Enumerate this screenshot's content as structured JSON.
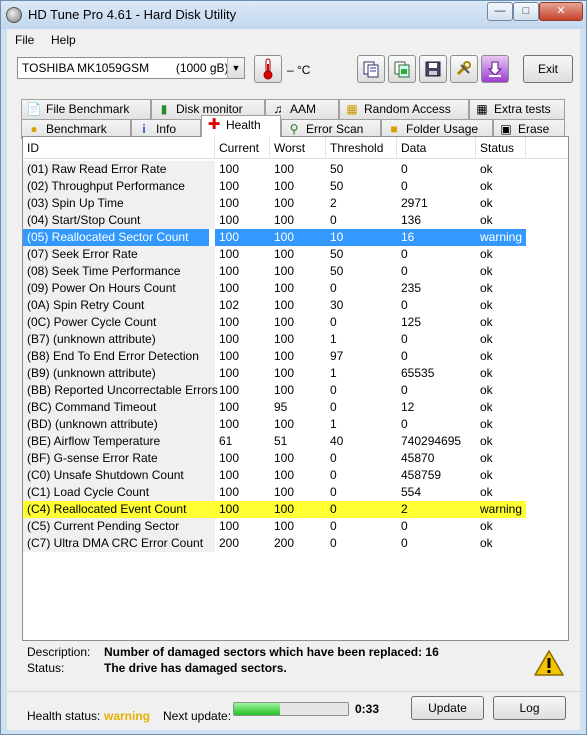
{
  "window": {
    "title": "HD Tune Pro 4.61 - Hard Disk Utility",
    "menu": [
      {
        "label": "File"
      },
      {
        "label": "Help"
      }
    ]
  },
  "toolbar": {
    "drive": "TOSHIBA MK1059GSM        (1000 gB)",
    "temperature": "– °C",
    "exit_label": "Exit"
  },
  "tabs_top": [
    {
      "label": "File Benchmark",
      "icon": "document-icon"
    },
    {
      "label": "Disk monitor",
      "icon": "chart-icon"
    },
    {
      "label": "AAM",
      "icon": "speaker-icon"
    },
    {
      "label": "Random Access",
      "icon": "grid-icon"
    },
    {
      "label": "Extra tests",
      "icon": "table-icon"
    }
  ],
  "tabs_bottom": [
    {
      "label": "Benchmark",
      "icon": "lightbulb-icon"
    },
    {
      "label": "Info",
      "icon": "info-icon"
    },
    {
      "label": "Health",
      "icon": "plus-icon"
    },
    {
      "label": "Error Scan",
      "icon": "magnifier-icon"
    },
    {
      "label": "Folder Usage",
      "icon": "folder-icon"
    },
    {
      "label": "Erase",
      "icon": "trash-icon"
    }
  ],
  "table": {
    "headers": [
      "ID",
      "Current",
      "Worst",
      "Threshold",
      "Data",
      "Status"
    ],
    "rows": [
      {
        "id": "(01) Raw Read Error Rate",
        "current": "100",
        "worst": "100",
        "threshold": "50",
        "data": "0",
        "status": "ok"
      },
      {
        "id": "(02) Throughput Performance",
        "current": "100",
        "worst": "100",
        "threshold": "50",
        "data": "0",
        "status": "ok"
      },
      {
        "id": "(03) Spin Up Time",
        "current": "100",
        "worst": "100",
        "threshold": "2",
        "data": "2971",
        "status": "ok"
      },
      {
        "id": "(04) Start/Stop Count",
        "current": "100",
        "worst": "100",
        "threshold": "0",
        "data": "136",
        "status": "ok"
      },
      {
        "id": "(05) Reallocated Sector Count",
        "current": "100",
        "worst": "100",
        "threshold": "10",
        "data": "16",
        "status": "warning",
        "highlight": "blue"
      },
      {
        "id": "(07) Seek Error Rate",
        "current": "100",
        "worst": "100",
        "threshold": "50",
        "data": "0",
        "status": "ok"
      },
      {
        "id": "(08) Seek Time Performance",
        "current": "100",
        "worst": "100",
        "threshold": "50",
        "data": "0",
        "status": "ok"
      },
      {
        "id": "(09) Power On Hours Count",
        "current": "100",
        "worst": "100",
        "threshold": "0",
        "data": "235",
        "status": "ok"
      },
      {
        "id": "(0A) Spin Retry Count",
        "current": "102",
        "worst": "100",
        "threshold": "30",
        "data": "0",
        "status": "ok"
      },
      {
        "id": "(0C) Power Cycle Count",
        "current": "100",
        "worst": "100",
        "threshold": "0",
        "data": "125",
        "status": "ok"
      },
      {
        "id": "(B7) (unknown attribute)",
        "current": "100",
        "worst": "100",
        "threshold": "1",
        "data": "0",
        "status": "ok"
      },
      {
        "id": "(B8) End To End Error Detection",
        "current": "100",
        "worst": "100",
        "threshold": "97",
        "data": "0",
        "status": "ok"
      },
      {
        "id": "(B9) (unknown attribute)",
        "current": "100",
        "worst": "100",
        "threshold": "1",
        "data": "65535",
        "status": "ok"
      },
      {
        "id": "(BB) Reported Uncorrectable Errors",
        "current": "100",
        "worst": "100",
        "threshold": "0",
        "data": "0",
        "status": "ok"
      },
      {
        "id": "(BC) Command Timeout",
        "current": "100",
        "worst": "95",
        "threshold": "0",
        "data": "12",
        "status": "ok"
      },
      {
        "id": "(BD) (unknown attribute)",
        "current": "100",
        "worst": "100",
        "threshold": "1",
        "data": "0",
        "status": "ok"
      },
      {
        "id": "(BE) Airflow Temperature",
        "current": "61",
        "worst": "51",
        "threshold": "40",
        "data": "740294695",
        "status": "ok"
      },
      {
        "id": "(BF) G-sense Error Rate",
        "current": "100",
        "worst": "100",
        "threshold": "0",
        "data": "45870",
        "status": "ok"
      },
      {
        "id": "(C0) Unsafe Shutdown Count",
        "current": "100",
        "worst": "100",
        "threshold": "0",
        "data": "458759",
        "status": "ok"
      },
      {
        "id": "(C1) Load Cycle Count",
        "current": "100",
        "worst": "100",
        "threshold": "0",
        "data": "554",
        "status": "ok"
      },
      {
        "id": "(C4) Reallocated Event Count",
        "current": "100",
        "worst": "100",
        "threshold": "0",
        "data": "2",
        "status": "warning",
        "highlight": "yellow"
      },
      {
        "id": "(C5) Current Pending Sector",
        "current": "100",
        "worst": "100",
        "threshold": "0",
        "data": "0",
        "status": "ok"
      },
      {
        "id": "(C7) Ultra DMA CRC Error Count",
        "current": "200",
        "worst": "200",
        "threshold": "0",
        "data": "0",
        "status": "ok"
      }
    ]
  },
  "description": {
    "desc_label": "Description:",
    "desc_value": "Number of damaged sectors which have been replaced: 16",
    "status_label": "Status:",
    "status_value": "The drive has damaged sectors."
  },
  "footer": {
    "health_label": "Health status:",
    "health_value": "warning",
    "next_update_label": "Next update:",
    "progress_fraction": 0.4,
    "countdown": "0:33",
    "update_label": "Update",
    "log_label": "Log"
  },
  "colors": {
    "selected_row": "#3399ff",
    "warning_row": "#ffff33",
    "health_warning": "#e8b000"
  }
}
